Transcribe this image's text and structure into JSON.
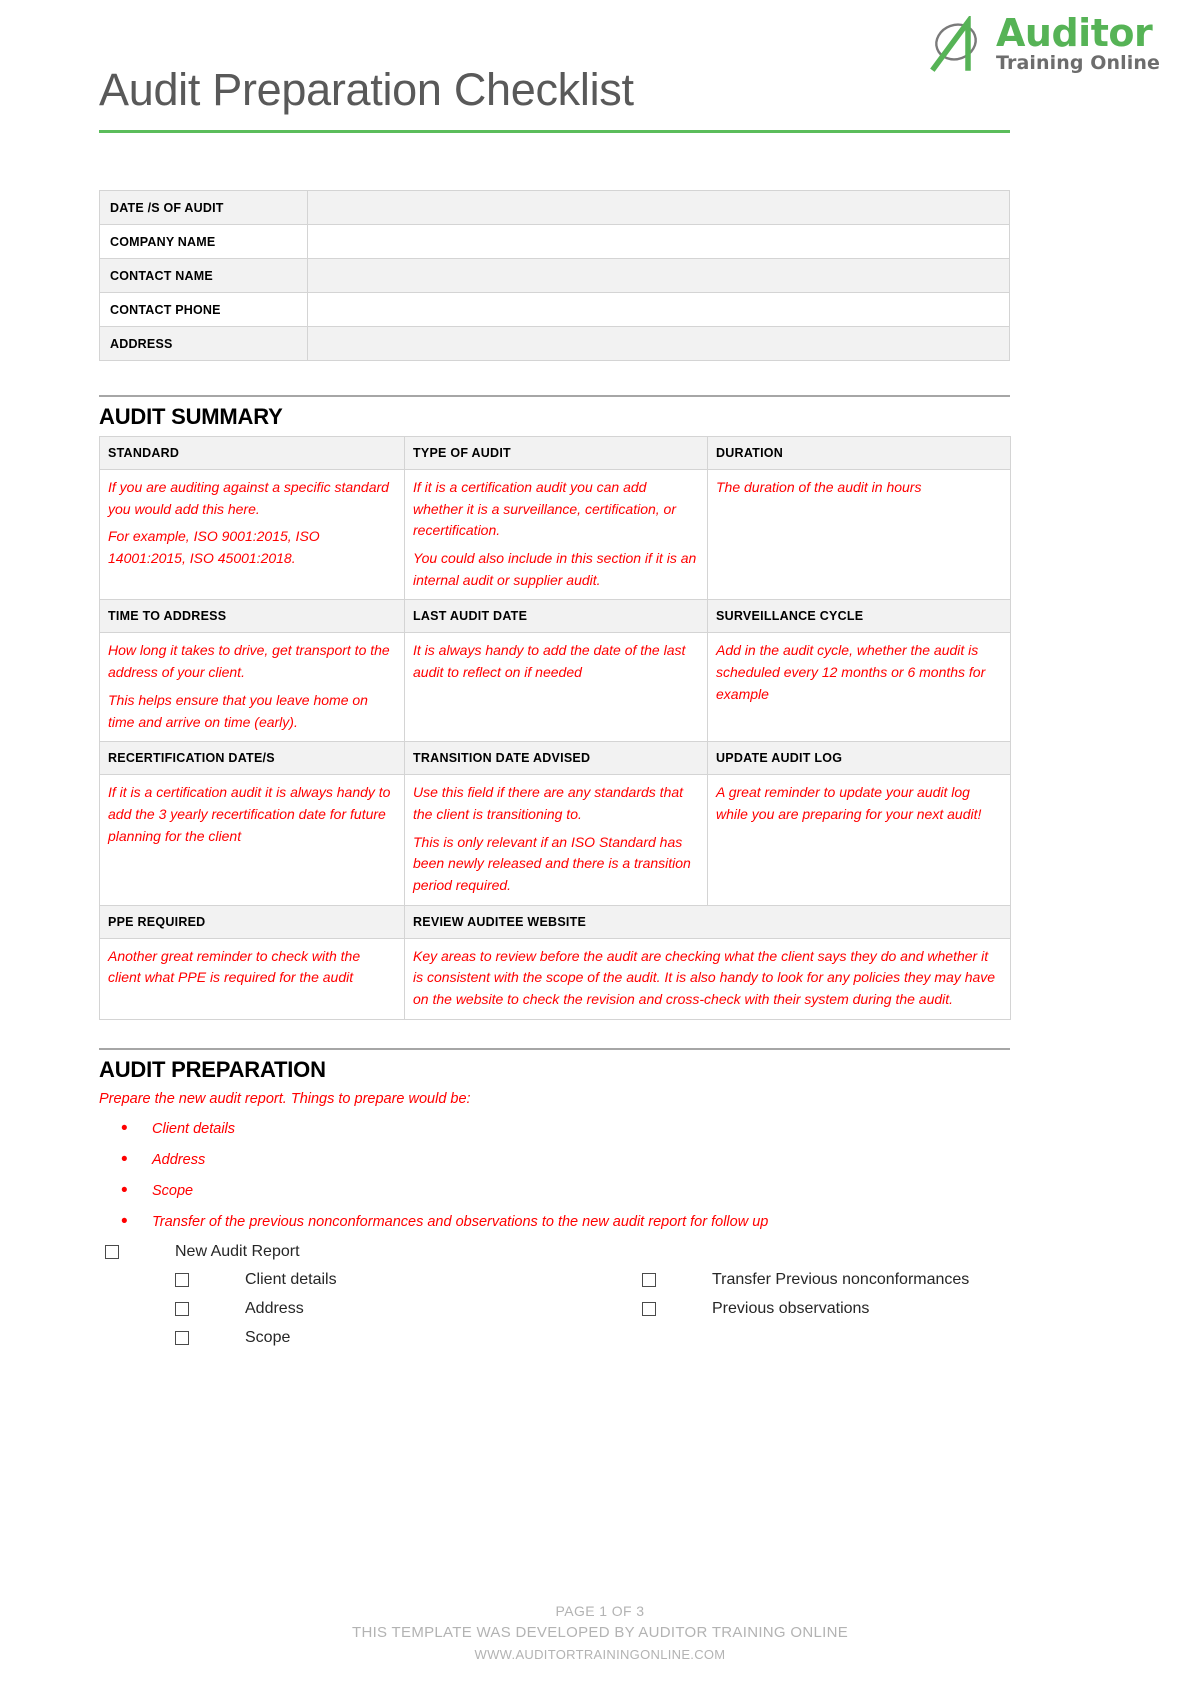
{
  "brand": {
    "logo_main": "Auditor",
    "logo_sub": "Training Online",
    "green": "#56b356",
    "gray": "#6d6d6d"
  },
  "header": {
    "title": "Audit Preparation Checklist",
    "rule_color": "#5bbd5b"
  },
  "info_table": {
    "rows": [
      {
        "label": "DATE /S OF AUDIT",
        "value": ""
      },
      {
        "label": "COMPANY NAME",
        "value": ""
      },
      {
        "label": "CONTACT NAME",
        "value": ""
      },
      {
        "label": "CONTACT PHONE",
        "value": ""
      },
      {
        "label": "ADDRESS",
        "value": ""
      }
    ]
  },
  "audit_summary": {
    "heading": "AUDIT SUMMARY",
    "block1": {
      "headers": [
        "STANDARD",
        "TYPE OF AUDIT",
        "DURATION"
      ],
      "cells": [
        {
          "paragraphs": [
            "If you are auditing against a specific standard you would add this here.",
            " For example, ISO 9001:2015, ISO 14001:2015, ISO 45001:2018."
          ]
        },
        {
          "paragraphs": [
            "If it is a certification audit you can add whether it is a surveillance, certification, or recertification.",
            "You could also include in this section if it is an internal audit or supplier audit."
          ]
        },
        {
          "paragraphs": [
            "The duration of the audit in hours"
          ]
        }
      ]
    },
    "block2": {
      "headers": [
        "TIME TO ADDRESS",
        "LAST AUDIT DATE",
        "SURVEILLANCE CYCLE"
      ],
      "cells": [
        {
          "paragraphs": [
            "How long it takes to drive, get transport to the address of your client.",
            "This helps ensure that you leave home on time and arrive on time (early)."
          ]
        },
        {
          "paragraphs": [
            "It is always handy to add the date of the last audit to reflect on if needed"
          ]
        },
        {
          "paragraphs": [
            "Add in the audit cycle, whether the audit is scheduled every 12 months or 6 months for example"
          ]
        }
      ]
    },
    "block3": {
      "headers": [
        "RECERTIFICATION DATE/S",
        "TRANSITION DATE ADVISED",
        "UPDATE AUDIT LOG"
      ],
      "cells": [
        {
          "paragraphs": [
            "If it is a certification audit it is always handy to add the 3 yearly recertification date for future planning for the client"
          ]
        },
        {
          "paragraphs": [
            "Use this field if there are any standards that the client is transitioning to.",
            "This is only relevant if an ISO Standard has been newly released and there is a transition period required."
          ]
        },
        {
          "paragraphs": [
            "A great reminder to update your audit log while you are preparing for your next audit!"
          ]
        }
      ]
    },
    "block4": {
      "headers": [
        "PPE REQUIRED",
        "REVIEW AUDITEE WEBSITE"
      ],
      "cells": [
        {
          "paragraphs": [
            "Another great reminder to check with the client what PPE is required for the audit"
          ]
        },
        {
          "paragraphs": [
            "Key areas to review before the audit are checking what the client says they do and whether it is consistent with the scope of the audit.  It is also handy to look for any policies they may have on the website to check the revision and cross-check with their system during the audit."
          ]
        }
      ]
    }
  },
  "audit_preparation": {
    "heading": "AUDIT PREPARATION",
    "intro": "Prepare the new audit report.  Things to prepare would be:",
    "bullets": [
      "Client details",
      "Address",
      "Scope",
      "Transfer of the previous nonconformances and observations to the new audit report for follow up"
    ],
    "main_checkbox": "New Audit Report",
    "checkbox_left": [
      "Client details",
      "Address",
      "Scope"
    ],
    "checkbox_right": [
      "Transfer Previous nonconformances",
      "Previous observations"
    ]
  },
  "footer": {
    "line1": "PAGE 1 OF 3",
    "line2": "THIS TEMPLATE WAS DEVELOPED BY AUDITOR TRAINING ONLINE",
    "line3": "WWW.AUDITORTRAININGONLINE.COM"
  }
}
